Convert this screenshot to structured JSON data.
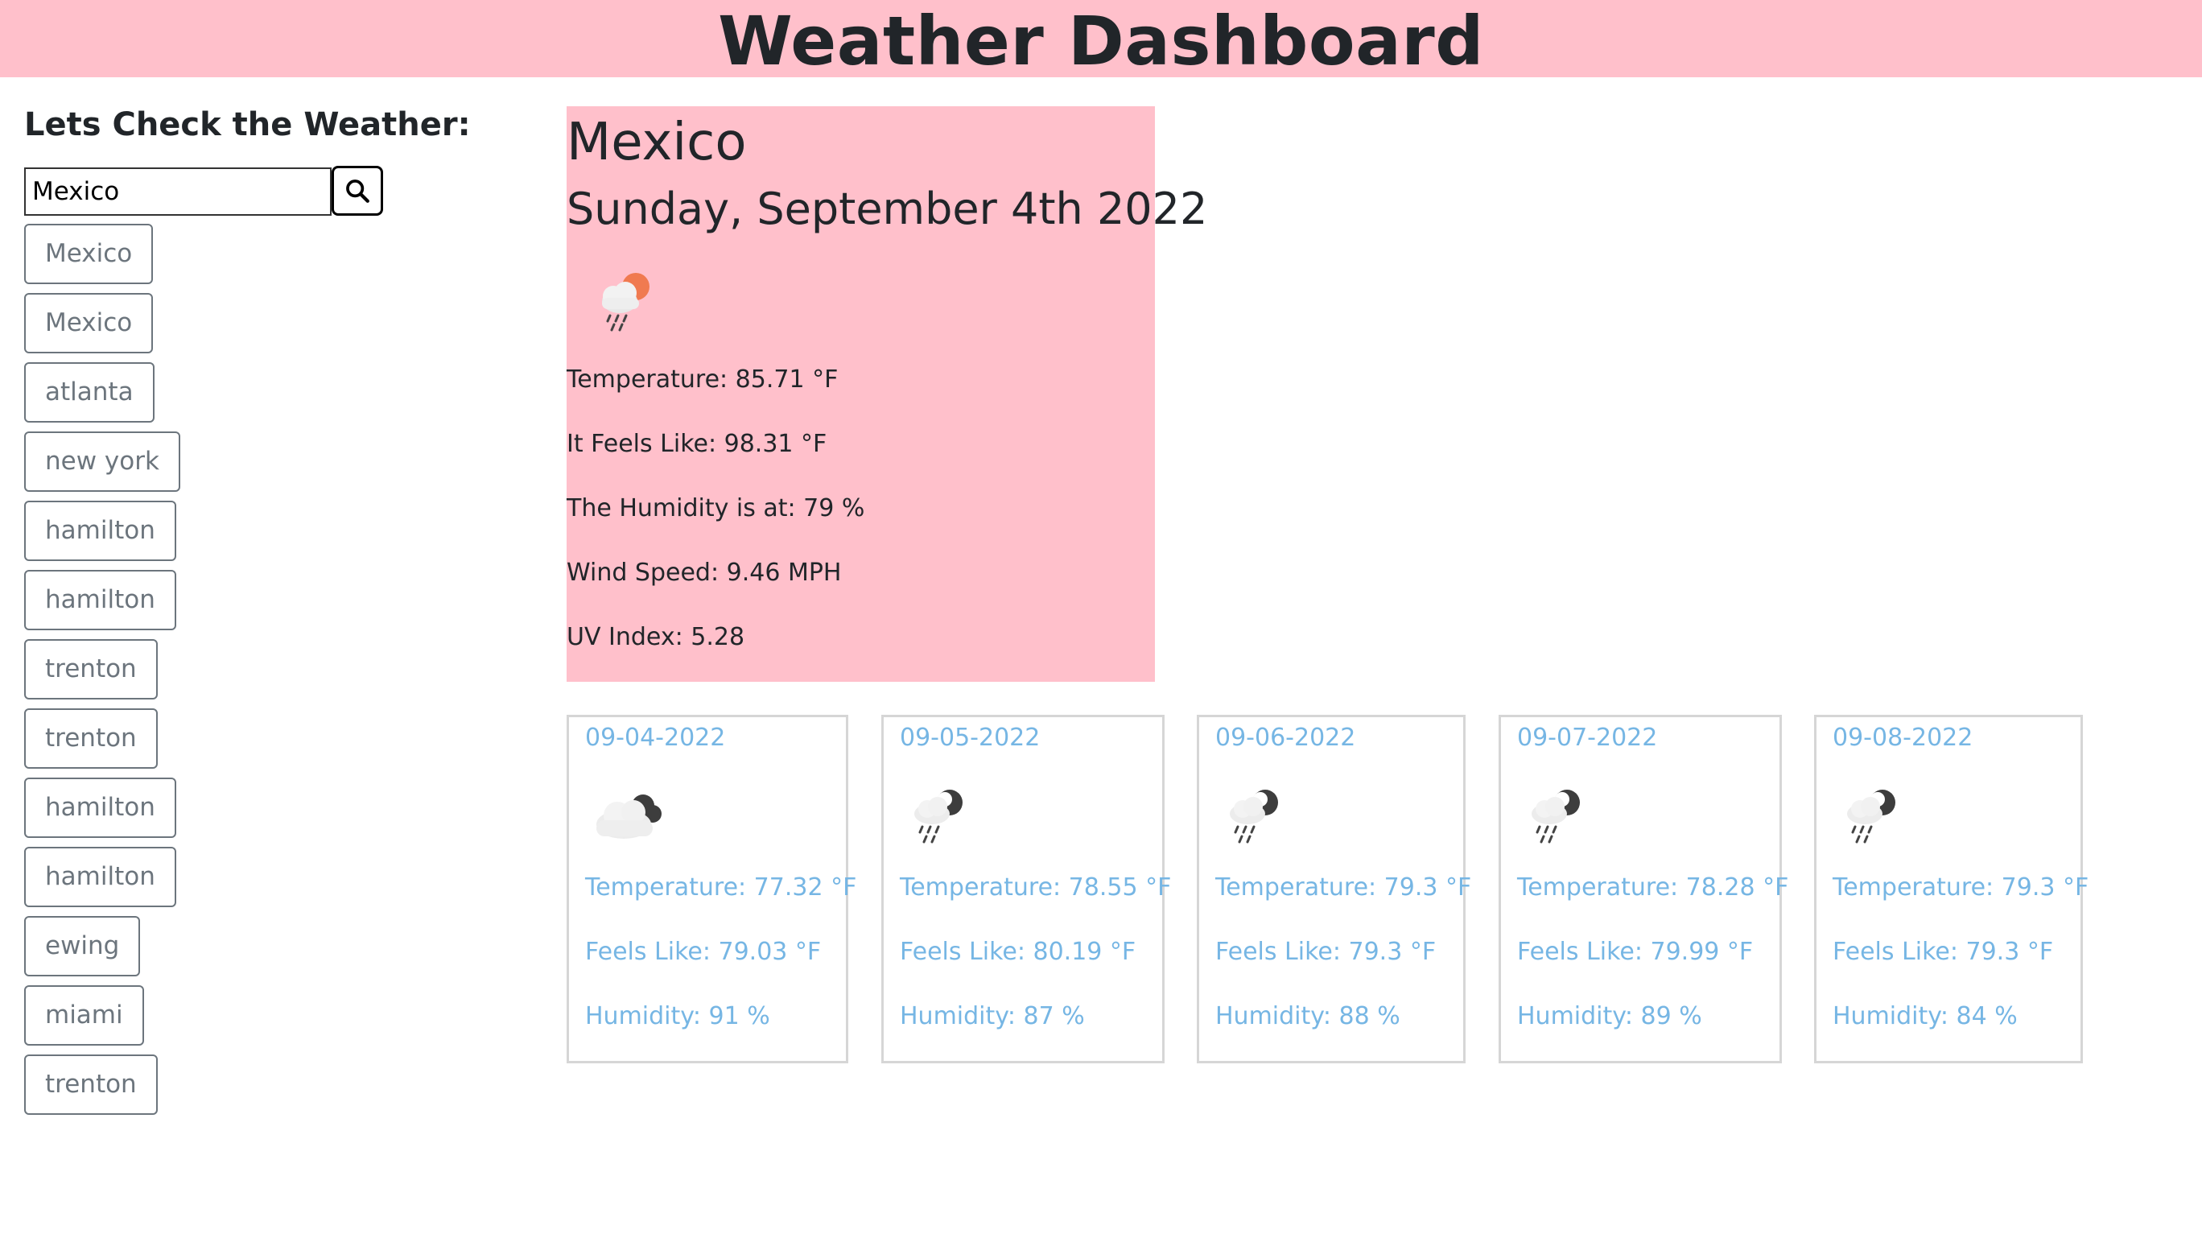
{
  "header": {
    "title": "Weather Dashboard"
  },
  "sidebar": {
    "title": "Lets Check the Weather:",
    "search_value": "Mexico",
    "search_icon": "search-icon",
    "history": [
      "Mexico",
      "Mexico",
      "atlanta",
      "new york",
      "hamilton",
      "hamilton",
      "trenton",
      "trenton",
      "hamilton",
      "hamilton",
      "ewing",
      "miami",
      "trenton"
    ]
  },
  "current": {
    "city": "Mexico",
    "date": "Sunday, September 4th 2022",
    "icon": "rain-sun-icon",
    "temperature": "Temperature: 85.71 °F",
    "feels_like": "It Feels Like: 98.31 °F",
    "humidity": "The Humidity is at: 79 %",
    "wind": "Wind Speed: 9.46 MPH",
    "uv": "UV Index: 5.28"
  },
  "forecast": [
    {
      "date": "09-04-2022",
      "icon": "cloudy-night-icon",
      "temp": "Temperature: 77.32 °F",
      "feels": "Feels Like: 79.03 °F",
      "humidity": "Humidity: 91 %"
    },
    {
      "date": "09-05-2022",
      "icon": "rain-night-icon",
      "temp": "Temperature: 78.55 °F",
      "feels": "Feels Like: 80.19 °F",
      "humidity": "Humidity: 87 %"
    },
    {
      "date": "09-06-2022",
      "icon": "rain-night-icon",
      "temp": "Temperature: 79.3 °F",
      "feels": "Feels Like: 79.3 °F",
      "humidity": "Humidity: 88 %"
    },
    {
      "date": "09-07-2022",
      "icon": "rain-night-icon",
      "temp": "Temperature: 78.28 °F",
      "feels": "Feels Like: 79.99 °F",
      "humidity": "Humidity: 89 %"
    },
    {
      "date": "09-08-2022",
      "icon": "rain-night-icon",
      "temp": "Temperature: 79.3 °F",
      "feels": "Feels Like: 79.3 °F",
      "humidity": "Humidity: 84 %"
    }
  ],
  "colors": {
    "header_bg": "#ffc0cb",
    "current_bg": "#ffc0cb",
    "forecast_text": "#76b6e4",
    "history_text": "#6c757d"
  }
}
